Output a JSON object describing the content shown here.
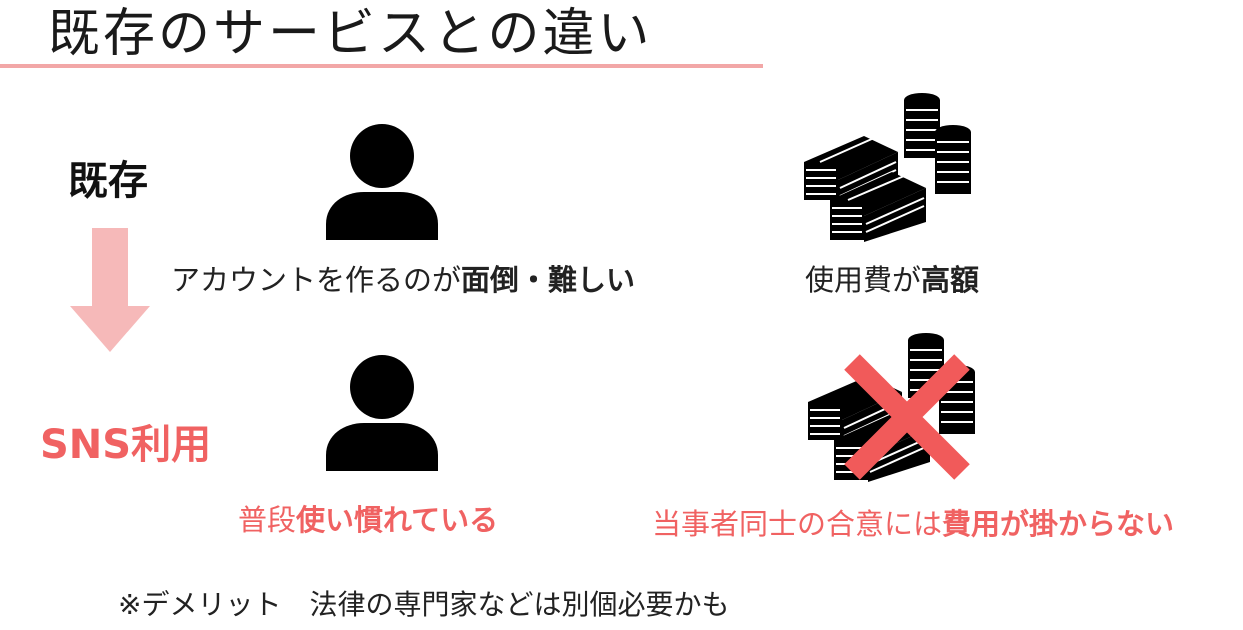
{
  "slide": {
    "title": "既存のサービスとの違い",
    "label_old": "既存",
    "label_sns": "SNS利用",
    "caption_account_prefix": "アカウントを作るのが",
    "caption_account_bold": "面倒・難しい",
    "caption_cost_prefix": "使用費が",
    "caption_cost_bold": "高額",
    "caption_usual_prefix": "普段",
    "caption_usual_bold": "使い慣れている",
    "caption_free_prefix": "当事者同士の合意には",
    "caption_free_bold": "費用が掛からない",
    "note": "※デメリット　法律の専門家などは別個必要かも"
  },
  "colors": {
    "accent_red": "#f06262",
    "underline_pink": "#f2a7a7",
    "arrow_pink": "#f6b9b9",
    "icon_black": "#000000",
    "cross_red": "#f15a5a"
  },
  "icons": [
    "person-icon",
    "money-stack-icon",
    "cross-icon",
    "down-arrow-icon"
  ]
}
